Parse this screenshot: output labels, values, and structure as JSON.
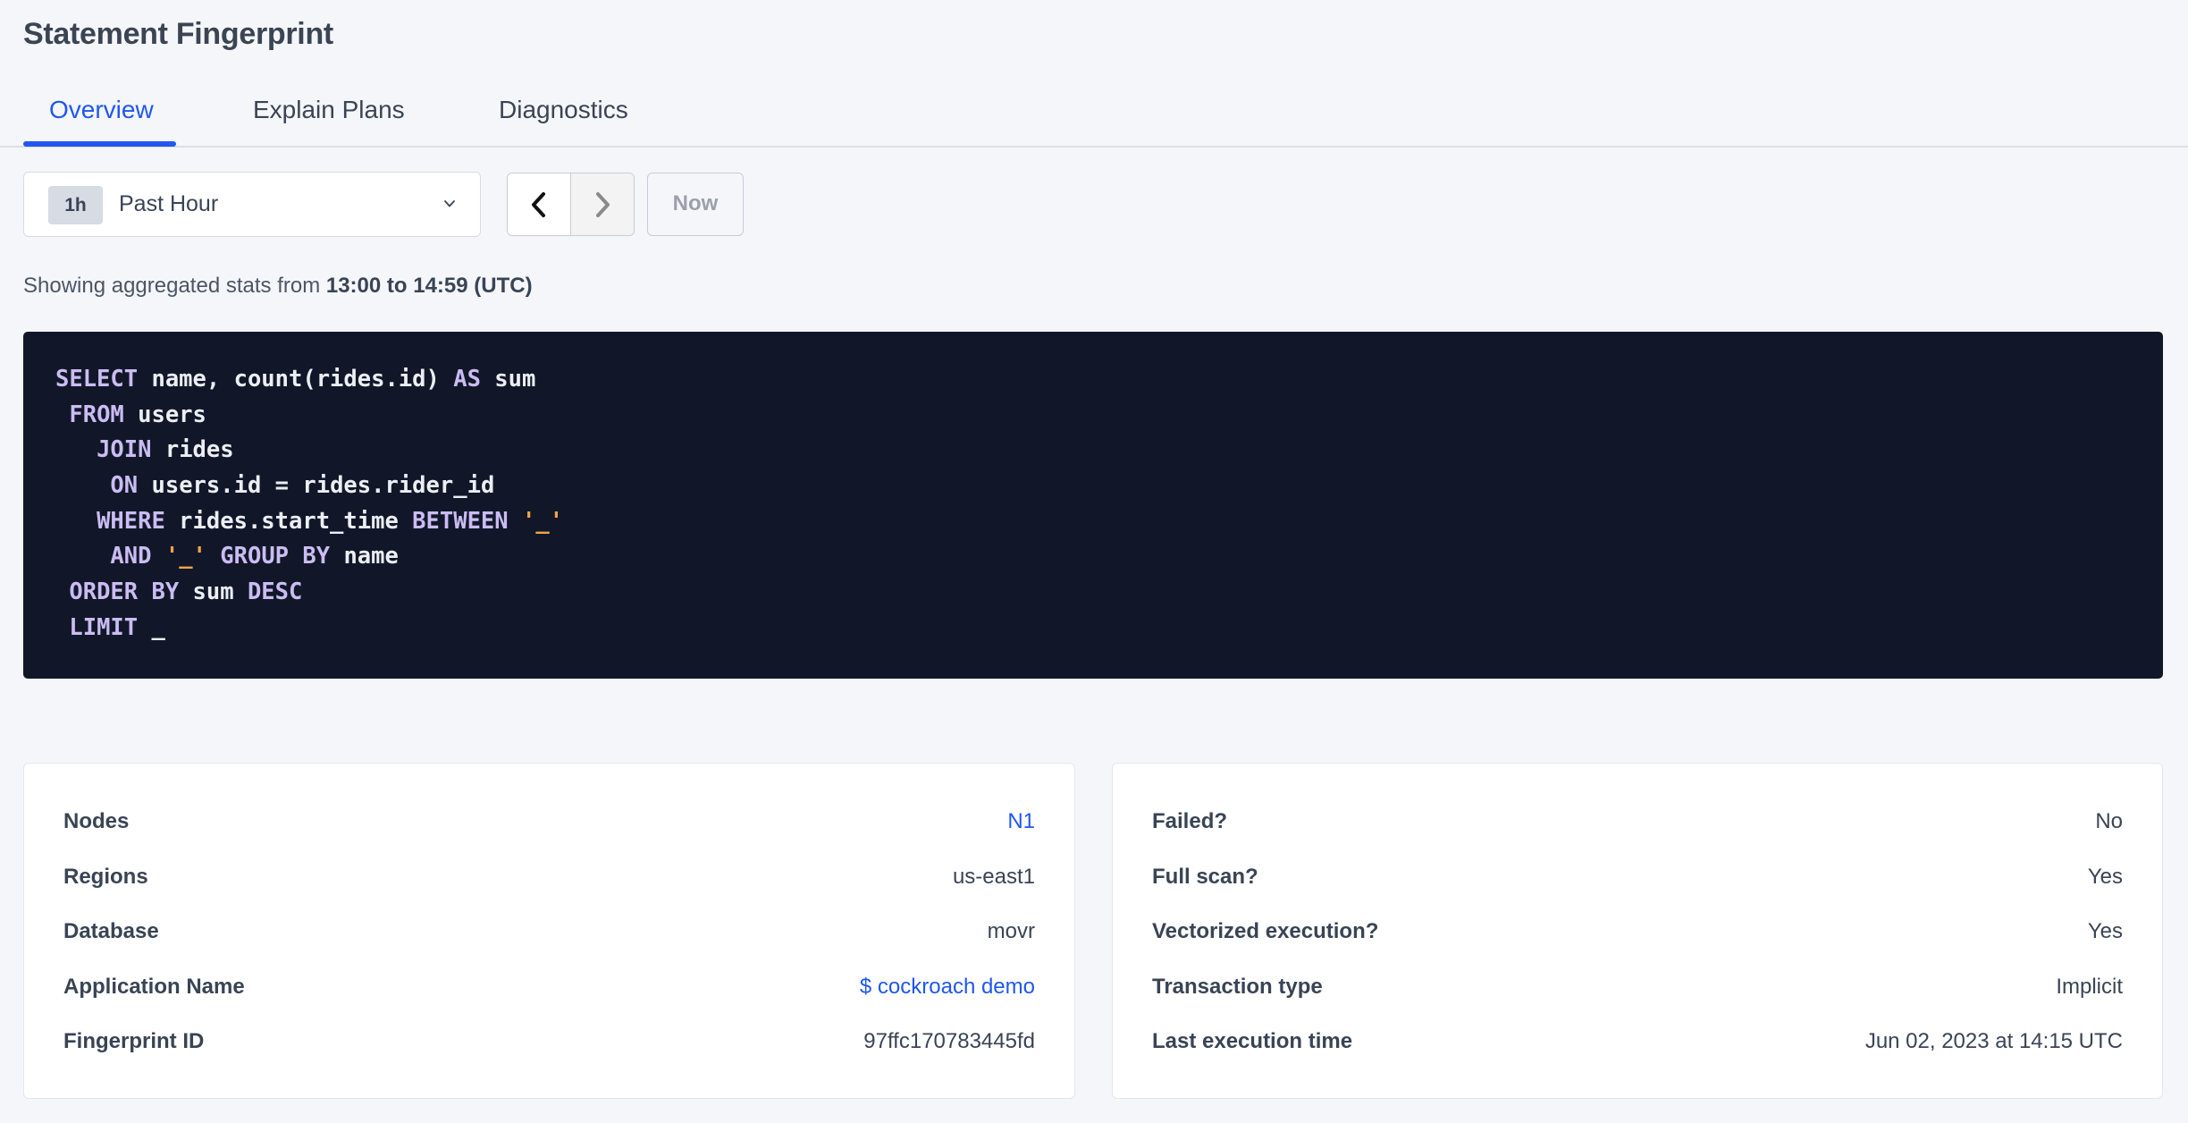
{
  "header": {
    "title": "Statement Fingerprint"
  },
  "tabs": [
    {
      "label": "Overview",
      "active": true
    },
    {
      "label": "Explain Plans",
      "active": false
    },
    {
      "label": "Diagnostics",
      "active": false
    }
  ],
  "time_controls": {
    "range_badge": "1h",
    "range_label": "Past Hour",
    "prev_icon": "chevron-left-icon",
    "next_icon": "chevron-right-icon",
    "now_label": "Now"
  },
  "range_info": {
    "prefix": "Showing aggregated stats from ",
    "range": "13:00 to 14:59 (UTC)"
  },
  "sql": {
    "lines": [
      [
        {
          "t": "SELECT",
          "k": "kw"
        },
        {
          "t": " name, count(rides.id) "
        },
        {
          "t": "AS",
          "k": "kw"
        },
        {
          "t": " sum"
        }
      ],
      [
        {
          "t": " "
        },
        {
          "t": "FROM",
          "k": "kw"
        },
        {
          "t": " users"
        }
      ],
      [
        {
          "t": "   "
        },
        {
          "t": "JOIN",
          "k": "kw"
        },
        {
          "t": " rides"
        }
      ],
      [
        {
          "t": "    "
        },
        {
          "t": "ON",
          "k": "kw"
        },
        {
          "t": " users.id = rides.rider_id"
        }
      ],
      [
        {
          "t": "   "
        },
        {
          "t": "WHERE",
          "k": "kw"
        },
        {
          "t": " rides.start_time "
        },
        {
          "t": "BETWEEN",
          "k": "kw"
        },
        {
          "t": " "
        },
        {
          "t": "'_'",
          "k": "str"
        }
      ],
      [
        {
          "t": "    "
        },
        {
          "t": "AND",
          "k": "kw"
        },
        {
          "t": " "
        },
        {
          "t": "'_'",
          "k": "str"
        },
        {
          "t": " "
        },
        {
          "t": "GROUP BY",
          "k": "kw"
        },
        {
          "t": " name"
        }
      ],
      [
        {
          "t": " "
        },
        {
          "t": "ORDER BY",
          "k": "kw"
        },
        {
          "t": " sum "
        },
        {
          "t": "DESC",
          "k": "kw"
        }
      ],
      [
        {
          "t": " "
        },
        {
          "t": "LIMIT",
          "k": "kw"
        },
        {
          "t": " _"
        }
      ]
    ]
  },
  "details_left": [
    {
      "label": "Nodes",
      "value": "N1",
      "link": true
    },
    {
      "label": "Regions",
      "value": "us-east1",
      "link": false
    },
    {
      "label": "Database",
      "value": "movr",
      "link": false
    },
    {
      "label": "Application Name",
      "value": "$ cockroach demo",
      "link": true
    },
    {
      "label": "Fingerprint ID",
      "value": "97ffc170783445fd",
      "link": false
    }
  ],
  "details_right": [
    {
      "label": "Failed?",
      "value": "No",
      "link": false
    },
    {
      "label": "Full scan?",
      "value": "Yes",
      "link": false
    },
    {
      "label": "Vectorized execution?",
      "value": "Yes",
      "link": false
    },
    {
      "label": "Transaction type",
      "value": "Implicit",
      "link": false
    },
    {
      "label": "Last execution time",
      "value": "Jun 02, 2023 at 14:15 UTC",
      "link": false
    }
  ],
  "colors": {
    "accent": "#1f57ef",
    "code_bg": "#111728",
    "code_keyword": "#cbbcf3",
    "code_string": "#f0a348",
    "page_bg": "#f5f6fa"
  }
}
